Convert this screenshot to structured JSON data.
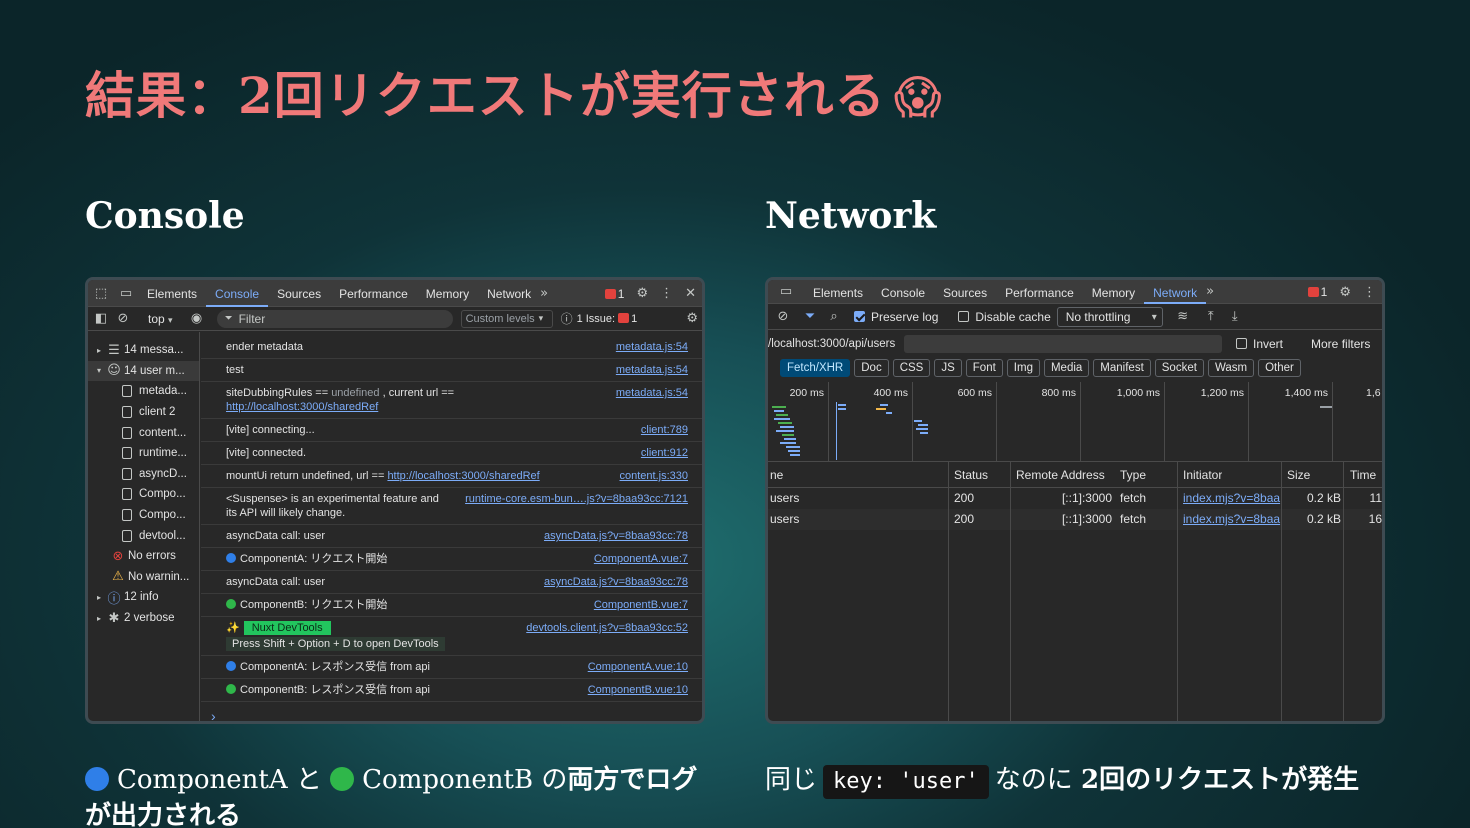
{
  "slide": {
    "title": "結果：2回リクエストが実行される",
    "title_emoji": "😱",
    "console_heading": "Console",
    "network_heading": "Network",
    "caption_left_a": "ComponentA",
    "caption_left_to": "と",
    "caption_left_b": "ComponentB",
    "caption_left_no": "の",
    "caption_left_bold": "両方でログ",
    "caption_left_line2": "が出力される",
    "caption_right_pre": "同じ",
    "caption_right_code": "key: 'user'",
    "caption_right_mid": "なのに",
    "caption_right_bold": "2回のリクエストが発生"
  },
  "console_panel": {
    "tabs": [
      "Elements",
      "Console",
      "Sources",
      "Performance",
      "Memory",
      "Network"
    ],
    "active_tab": "Console",
    "issues_badge": "1",
    "context": "top",
    "filter_placeholder": "Filter",
    "levels": "Custom levels",
    "issue_text": "1 Issue:",
    "issue_count": "1",
    "sidebar": [
      {
        "label": "14 messa...",
        "icon": "list-icon",
        "tri": "▸"
      },
      {
        "label": "14 user m...",
        "icon": "user-icon",
        "tri": "▾"
      },
      {
        "label": "metada...",
        "icon": "file-icon",
        "tri": ""
      },
      {
        "label": "client  2",
        "icon": "file-icon",
        "tri": ""
      },
      {
        "label": "content...",
        "icon": "file-icon",
        "tri": ""
      },
      {
        "label": "runtime...",
        "icon": "file-icon",
        "tri": ""
      },
      {
        "label": "asyncD...",
        "icon": "file-icon",
        "tri": ""
      },
      {
        "label": "Compo...",
        "icon": "file-icon",
        "tri": ""
      },
      {
        "label": "Compo...",
        "icon": "file-icon",
        "tri": ""
      },
      {
        "label": "devtool...",
        "icon": "file-icon",
        "tri": ""
      },
      {
        "label": "No errors",
        "icon": "error-icon",
        "tri": ""
      },
      {
        "label": "No warnin...",
        "icon": "warning-icon",
        "tri": ""
      },
      {
        "label": "12 info",
        "icon": "info-icon",
        "tri": "▸"
      },
      {
        "label": "2 verbose",
        "icon": "bug-icon",
        "tri": "▸"
      }
    ],
    "logs": {
      "l1": {
        "text": "ender metadata",
        "src": "metadata.js:54"
      },
      "l2": {
        "text": "test",
        "src": "metadata.js:54"
      },
      "l3": {
        "pre": "siteDubbingRules ==",
        "undef": "undefined",
        "mid": ", current url ==",
        "url": "http://localhost:3000/sharedRef",
        "src": "metadata.js:54"
      },
      "l4": {
        "text": "[vite] connecting...",
        "src": "client:789"
      },
      "l5": {
        "text": "[vite] connected.",
        "src": "client:912"
      },
      "l6": {
        "pre": "mountUi return undefined, url ==",
        "url": "http://localhost:3000/sharedRef",
        "src": "content.js:330"
      },
      "l7": {
        "text": "<Suspense> is an experimental feature and",
        "text2": "its API will likely change.",
        "src": "runtime-core.esm-bun….js?v=8baa93cc:7121"
      },
      "l8": {
        "text": "asyncData call: user",
        "src": "asyncData.js?v=8baa93cc:78"
      },
      "l9": {
        "text": "ComponentA: リクエスト開始",
        "src": "ComponentA.vue:7",
        "dot": "#2f7fe8"
      },
      "l10": {
        "text": "asyncData call: user",
        "src": "asyncData.js?v=8baa93cc:78"
      },
      "l11": {
        "text": "ComponentB: リクエスト開始",
        "src": "ComponentB.vue:7",
        "dot": "#2fb74a"
      },
      "l12": {
        "tag": "Nuxt DevTools",
        "hint": "Press Shift + Option + D to open DevTools",
        "src": "devtools.client.js?v=8baa93cc:52",
        "sparkle": "✨"
      },
      "l13": {
        "text": "ComponentA: レスポンス受信 from api",
        "src": "ComponentA.vue:10",
        "dot": "#2f7fe8"
      },
      "l14": {
        "text": "ComponentB: レスポンス受信 from api",
        "src": "ComponentB.vue:10",
        "dot": "#2fb74a"
      }
    },
    "prompt": "›"
  },
  "network_panel": {
    "tabs": [
      "Elements",
      "Console",
      "Sources",
      "Performance",
      "Memory",
      "Network"
    ],
    "active_tab": "Network",
    "issues_badge": "1",
    "preserve_log": "Preserve log",
    "disable_cache": "Disable cache",
    "throttling": "No throttling",
    "filter_value": "/localhost:3000/api/users",
    "invert": "Invert",
    "more_filters": "More filters",
    "type_filters": [
      "Fetch/XHR",
      "Doc",
      "CSS",
      "JS",
      "Font",
      "Img",
      "Media",
      "Manifest",
      "Socket",
      "Wasm",
      "Other"
    ],
    "active_type": "Fetch/XHR",
    "timeline_ticks": [
      "200 ms",
      "400 ms",
      "600 ms",
      "800 ms",
      "1,000 ms",
      "1,200 ms",
      "1,400 ms",
      "1,6"
    ],
    "columns": [
      "ne",
      "Status",
      "Remote Address",
      "Type",
      "Initiator",
      "Size",
      "Time"
    ],
    "rows": [
      {
        "name": "users",
        "status": "200",
        "remote": "[::1]:3000",
        "type": "fetch",
        "initiator": "index.mjs?v=8baa",
        "size": "0.2 kB",
        "time": "11"
      },
      {
        "name": "users",
        "status": "200",
        "remote": "[::1]:3000",
        "type": "fetch",
        "initiator": "index.mjs?v=8baa",
        "size": "0.2 kB",
        "time": "16"
      }
    ]
  },
  "colors": {
    "title": "#f07979",
    "devtools_bg": "#282828",
    "accent_blue": "#7cacf8",
    "componentA": "#2f7fe8",
    "componentB": "#2fb74a"
  }
}
